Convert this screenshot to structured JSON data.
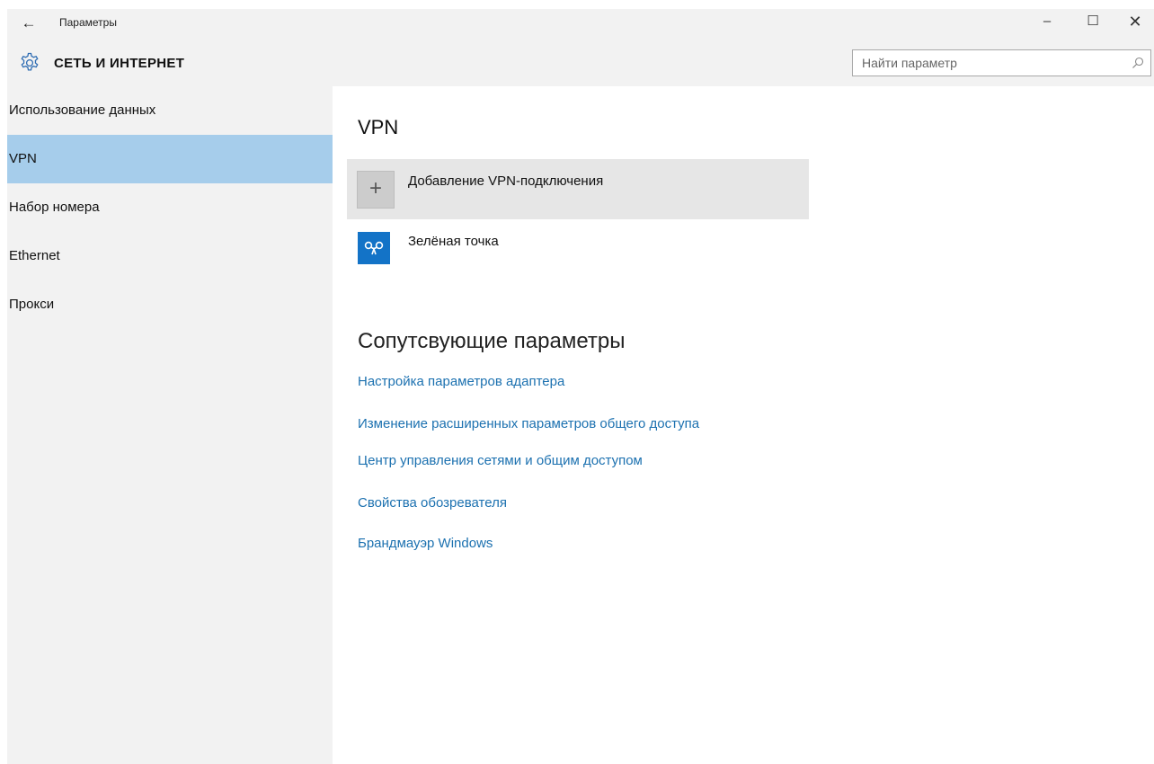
{
  "window": {
    "title": "Параметры",
    "back_glyph": "←",
    "minimize_glyph": "–",
    "maximize_glyph": "☐",
    "close_glyph": "✕"
  },
  "header": {
    "section_title": "СЕТЬ И ИНТЕРНЕТ",
    "icon": "gear-icon"
  },
  "search": {
    "placeholder": "Найти параметр",
    "value": "",
    "icon": "search-icon"
  },
  "sidebar": {
    "items": [
      {
        "label": "Использование данных",
        "selected": false
      },
      {
        "label": "VPN",
        "selected": true
      },
      {
        "label": "Набор номера",
        "selected": false
      },
      {
        "label": "Ethernet",
        "selected": false
      },
      {
        "label": "Прокси",
        "selected": false
      }
    ]
  },
  "main": {
    "vpn_heading": "VPN",
    "add_vpn": {
      "label": "Добавление VPN-подключения",
      "icon": "plus-icon"
    },
    "connections": [
      {
        "name": "Зелёная точка",
        "icon": "vpn-connection-icon"
      }
    ],
    "related_heading": "Сопутсвующие параметры",
    "related_links": [
      "Настройка параметров адаптера",
      "Изменение расширенных параметров общего доступа",
      "Центр управления сетями и общим доступом",
      "Свойства обозревателя",
      "Брандмауэр Windows"
    ]
  },
  "colors": {
    "accent": "#1c71b0",
    "selected_nav": "#a6cdeb",
    "sidebar_bg": "#f2f2f2",
    "vpn_tile": "#1373c7"
  }
}
